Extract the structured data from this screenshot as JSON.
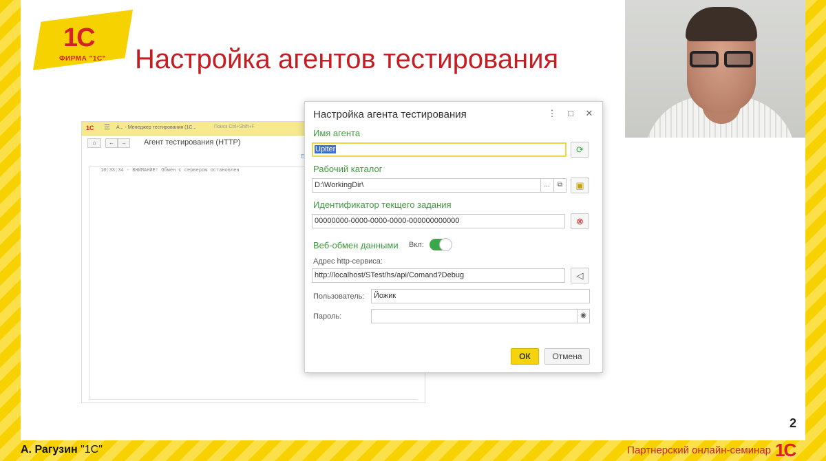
{
  "slide": {
    "logo_text": "1С",
    "logo_caption": "ФИРМА \"1С\"",
    "title": "Настройка агентов тестирования",
    "page_number": "2"
  },
  "bg_window": {
    "logo": "1С",
    "menu_icon": "☰",
    "title": "А...  - Менеджер тестирования (1С...",
    "search": "Поиск Ctrl+Shift+F",
    "home": "⌂",
    "back": "←",
    "forward": "→",
    "heading": "Агент тестирования (HTTP)",
    "log_line": "10:33:34 - ВНИМАНИЕ! Обмен с сервером остановлен",
    "mark": "Е"
  },
  "dialog": {
    "title": "Настройка агента тестирования",
    "more_icon": "⋮",
    "maximize_icon": "□",
    "close_icon": "✕",
    "agent_name_label": "Имя агента",
    "agent_name_value": "Upiter",
    "refresh_icon": "⟳",
    "workdir_label": "Рабочий каталог",
    "workdir_value": "D:\\WorkingDir\\",
    "ellipsis": "...",
    "copy_icon": "⧉",
    "folder_icon": "▣",
    "task_id_label": "Идентификатор текщего задания",
    "task_id_value": "00000000-0000-0000-0000-000000000000",
    "clear_icon": "⊗",
    "web_exchange_label": "Веб-обмен данными",
    "toggle_label": "Вкл:",
    "toggle_on": true,
    "http_label": "Адрес http-сервиса:",
    "http_value": "http://localhost/STest/hs/api/Comand?Debug",
    "send_icon": "◁",
    "user_label": "Пользователь:",
    "user_value": "Йожик",
    "password_label": "Пароль:",
    "password_value": "",
    "eye_icon": "◉",
    "ok_label": "ОК",
    "cancel_label": "Отмена"
  },
  "footer": {
    "presenter_name": "А. Рагузин",
    "presenter_company": "\"1С\"",
    "event": "Партнерский онлайн-семинар",
    "logo": "1С"
  },
  "colors": {
    "brand_red": "#c41e25",
    "brand_yellow": "#f7d200",
    "label_green": "#3f9b3f",
    "toggle_green": "#3aa84a"
  }
}
